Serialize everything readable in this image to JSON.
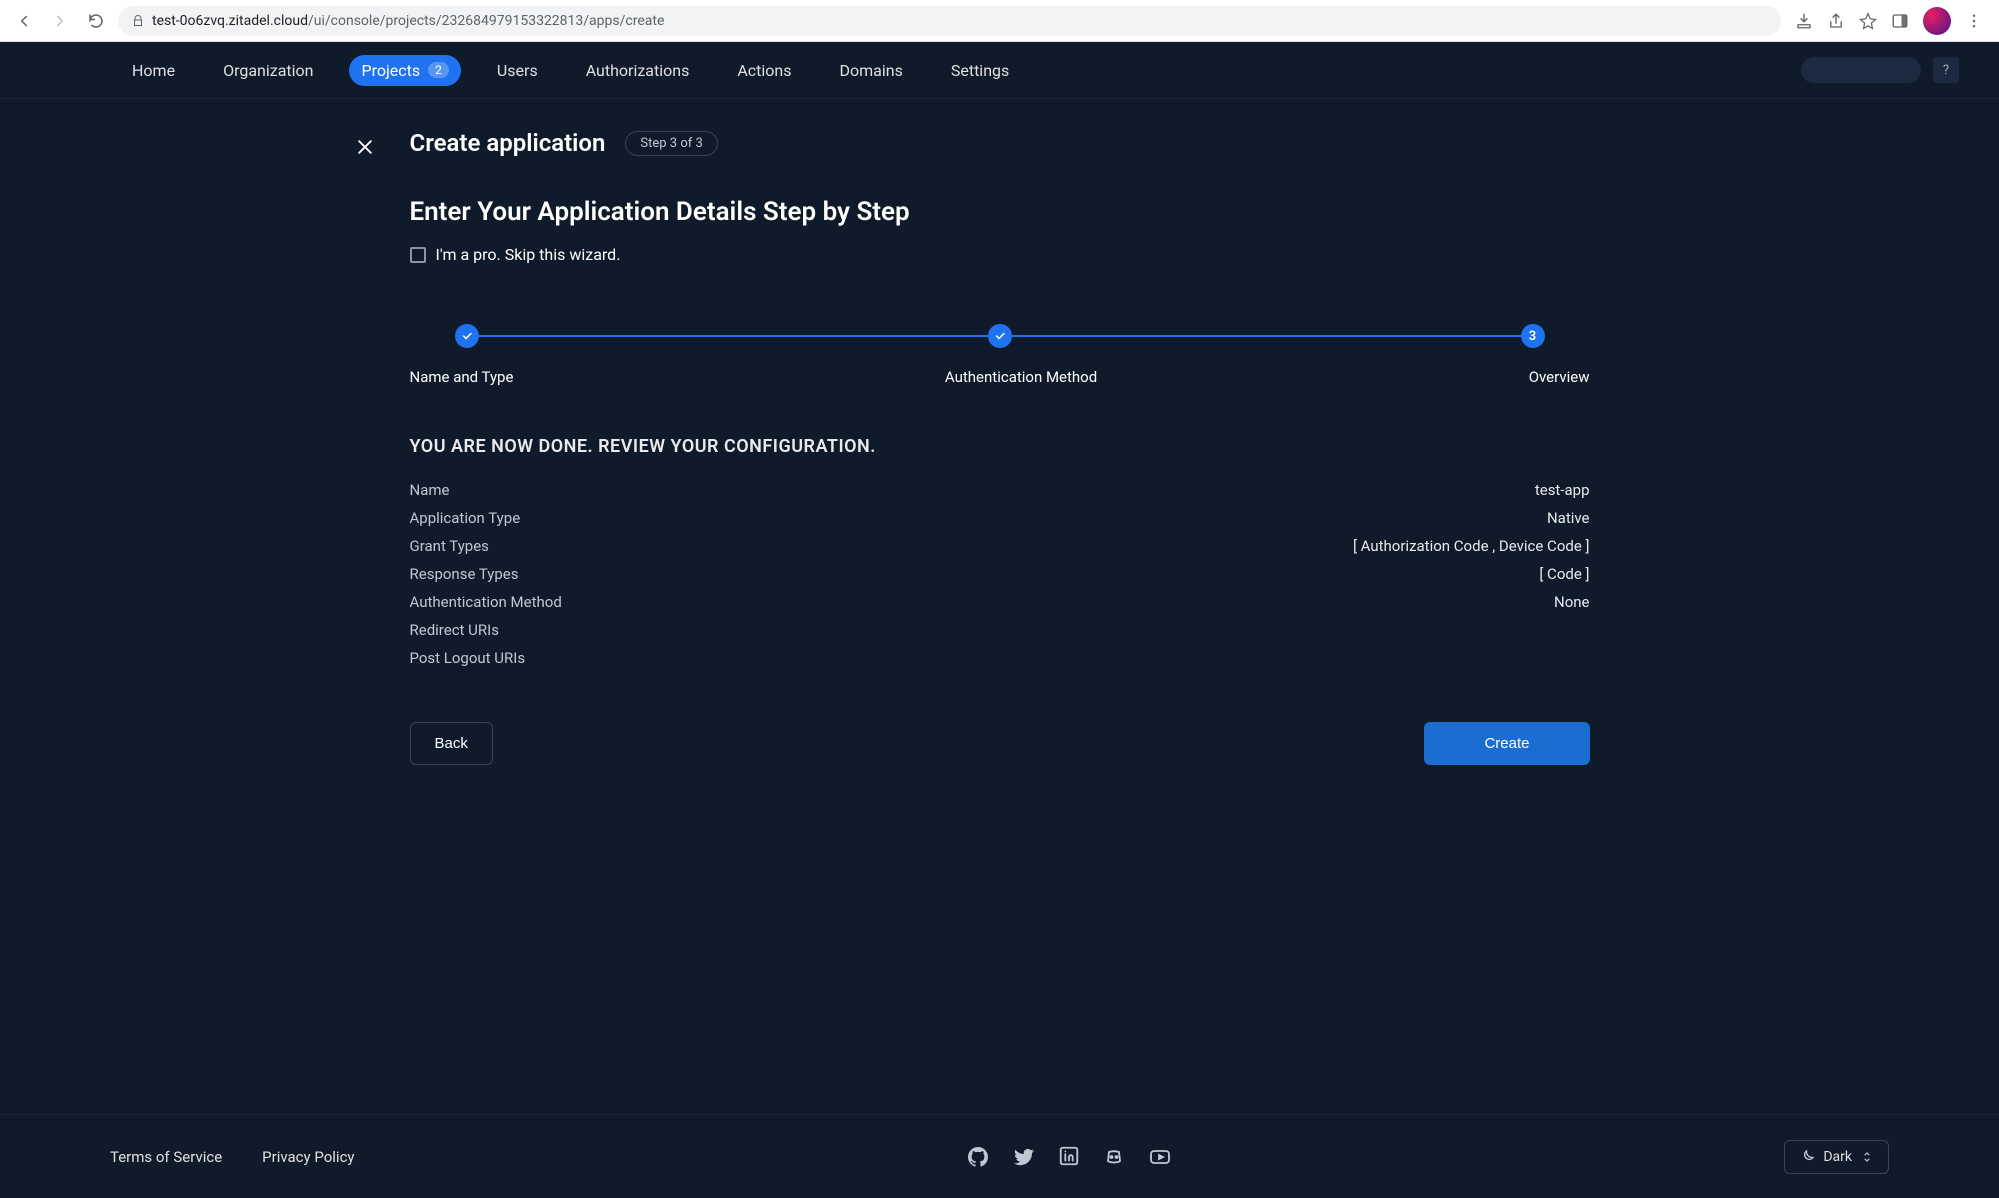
{
  "browser": {
    "url_host": "test-0o6zvq.zitadel.cloud",
    "url_path": "/ui/console/projects/232684979153322813/apps/create"
  },
  "nav": {
    "items": [
      {
        "label": "Home"
      },
      {
        "label": "Organization"
      },
      {
        "label": "Projects",
        "badge": "2",
        "active": true
      },
      {
        "label": "Users"
      },
      {
        "label": "Authorizations"
      },
      {
        "label": "Actions"
      },
      {
        "label": "Domains"
      },
      {
        "label": "Settings"
      }
    ],
    "help": "?"
  },
  "header": {
    "title": "Create application",
    "step_indicator": "Step 3 of 3",
    "subtitle": "Enter Your Application Details Step by Step",
    "skip_label": "I'm a pro. Skip this wizard."
  },
  "stepper": {
    "steps": [
      {
        "label": "Name and Type",
        "state": "done"
      },
      {
        "label": "Authentication Method",
        "state": "done"
      },
      {
        "label": "Overview",
        "state": "current",
        "number": "3"
      }
    ]
  },
  "review": {
    "title": "YOU ARE NOW DONE. REVIEW YOUR CONFIGURATION.",
    "rows": [
      {
        "label": "Name",
        "value": "test-app"
      },
      {
        "label": "Application Type",
        "value": "Native"
      },
      {
        "label": "Grant Types",
        "value": "[ Authorization Code , Device Code ]"
      },
      {
        "label": "Response Types",
        "value": "[ Code ]"
      },
      {
        "label": "Authentication Method",
        "value": "None"
      },
      {
        "label": "Redirect URIs",
        "value": ""
      },
      {
        "label": "Post Logout URIs",
        "value": ""
      }
    ]
  },
  "buttons": {
    "back": "Back",
    "create": "Create"
  },
  "footer": {
    "tos": "Terms of Service",
    "privacy": "Privacy Policy",
    "theme": "Dark"
  }
}
